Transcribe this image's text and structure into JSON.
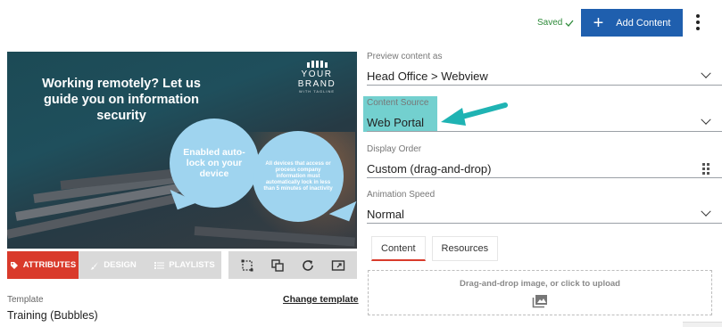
{
  "header": {
    "saved_label": "Saved",
    "add_content_label": "Add Content"
  },
  "preview": {
    "headline": "Working remotely? Let us guide you on information security",
    "brand_name": "YOUR BRAND",
    "brand_tagline": "WITH TAGLINE",
    "bubble1_text": "Enabled auto-lock on your device",
    "bubble2_text": "All devices that access or process company information must automatically lock in less than 5 minutes of inactivity"
  },
  "editor_tabs": [
    {
      "label": "ATTRIBUTES",
      "icon": "tag-icon"
    },
    {
      "label": "DESIGN",
      "icon": "brush-icon"
    },
    {
      "label": "PLAYLISTS",
      "icon": "list-icon"
    }
  ],
  "toolbox_icons": [
    "crop-icon",
    "copy-icon",
    "refresh-icon",
    "fullscreen-icon"
  ],
  "template": {
    "label": "Template",
    "value": "Training (Bubbles)",
    "change_label": "Change template"
  },
  "form": {
    "preview_as": {
      "label": "Preview content as",
      "value": "Head Office > Webview"
    },
    "content_source": {
      "label": "Content Source",
      "value": "Web Portal"
    },
    "display_order": {
      "label": "Display Order",
      "value": "Custom (drag-and-drop)"
    },
    "animation_speed": {
      "label": "Animation Speed",
      "value": "Normal"
    }
  },
  "content_tabs": [
    {
      "label": "Content"
    },
    {
      "label": "Resources"
    }
  ],
  "upload": {
    "text": "Drag-and-drop image, or click to upload"
  },
  "colors": {
    "accent_blue": "#1f5fae",
    "accent_red": "#d93a2b",
    "highlight_teal": "#5bc8c7",
    "saved_green": "#2e8b3a"
  }
}
